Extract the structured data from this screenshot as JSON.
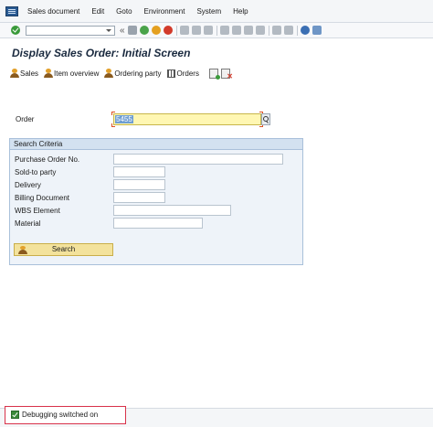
{
  "menu": {
    "items": [
      "Sales document",
      "Edit",
      "Goto",
      "Environment",
      "System",
      "Help"
    ]
  },
  "toolbar": {
    "command_field_value": "",
    "icons": [
      "enter-icon",
      "command-field",
      "collapse-icon",
      "save-icon",
      "back-icon",
      "exit-icon",
      "cancel-icon",
      "print-icon",
      "find-icon",
      "find-next-icon",
      "first-page-icon",
      "previous-page-icon",
      "next-page-icon",
      "last-page-icon",
      "create-session-icon",
      "shortcut-icon",
      "help-icon",
      "layout-icon"
    ]
  },
  "page": {
    "title": "Display Sales Order: Initial Screen"
  },
  "app_toolbar": {
    "sales_label": "Sales",
    "item_overview_label": "Item overview",
    "ordering_party_label": "Ordering party",
    "orders_label": "Orders"
  },
  "order": {
    "label": "Order",
    "value": "5455"
  },
  "search_criteria": {
    "title": "Search Criteria",
    "fields": [
      {
        "label": "Purchase Order No.",
        "value": ""
      },
      {
        "label": "Sold-to party",
        "value": ""
      },
      {
        "label": "Delivery",
        "value": ""
      },
      {
        "label": "Billing Document",
        "value": ""
      },
      {
        "label": "WBS Element",
        "value": ""
      },
      {
        "label": "Material",
        "value": ""
      }
    ],
    "search_button_label": "Search"
  },
  "status": {
    "debug_text": "Debugging switched on",
    "debug_checked": true
  },
  "colors": {
    "title": "#1a2a3f",
    "highlight_field": "#fff7b3",
    "selection": "#6f9ed2",
    "group_background": "#eef3f9",
    "search_button": "#f3e29c",
    "debug_border": "#d8324a"
  }
}
